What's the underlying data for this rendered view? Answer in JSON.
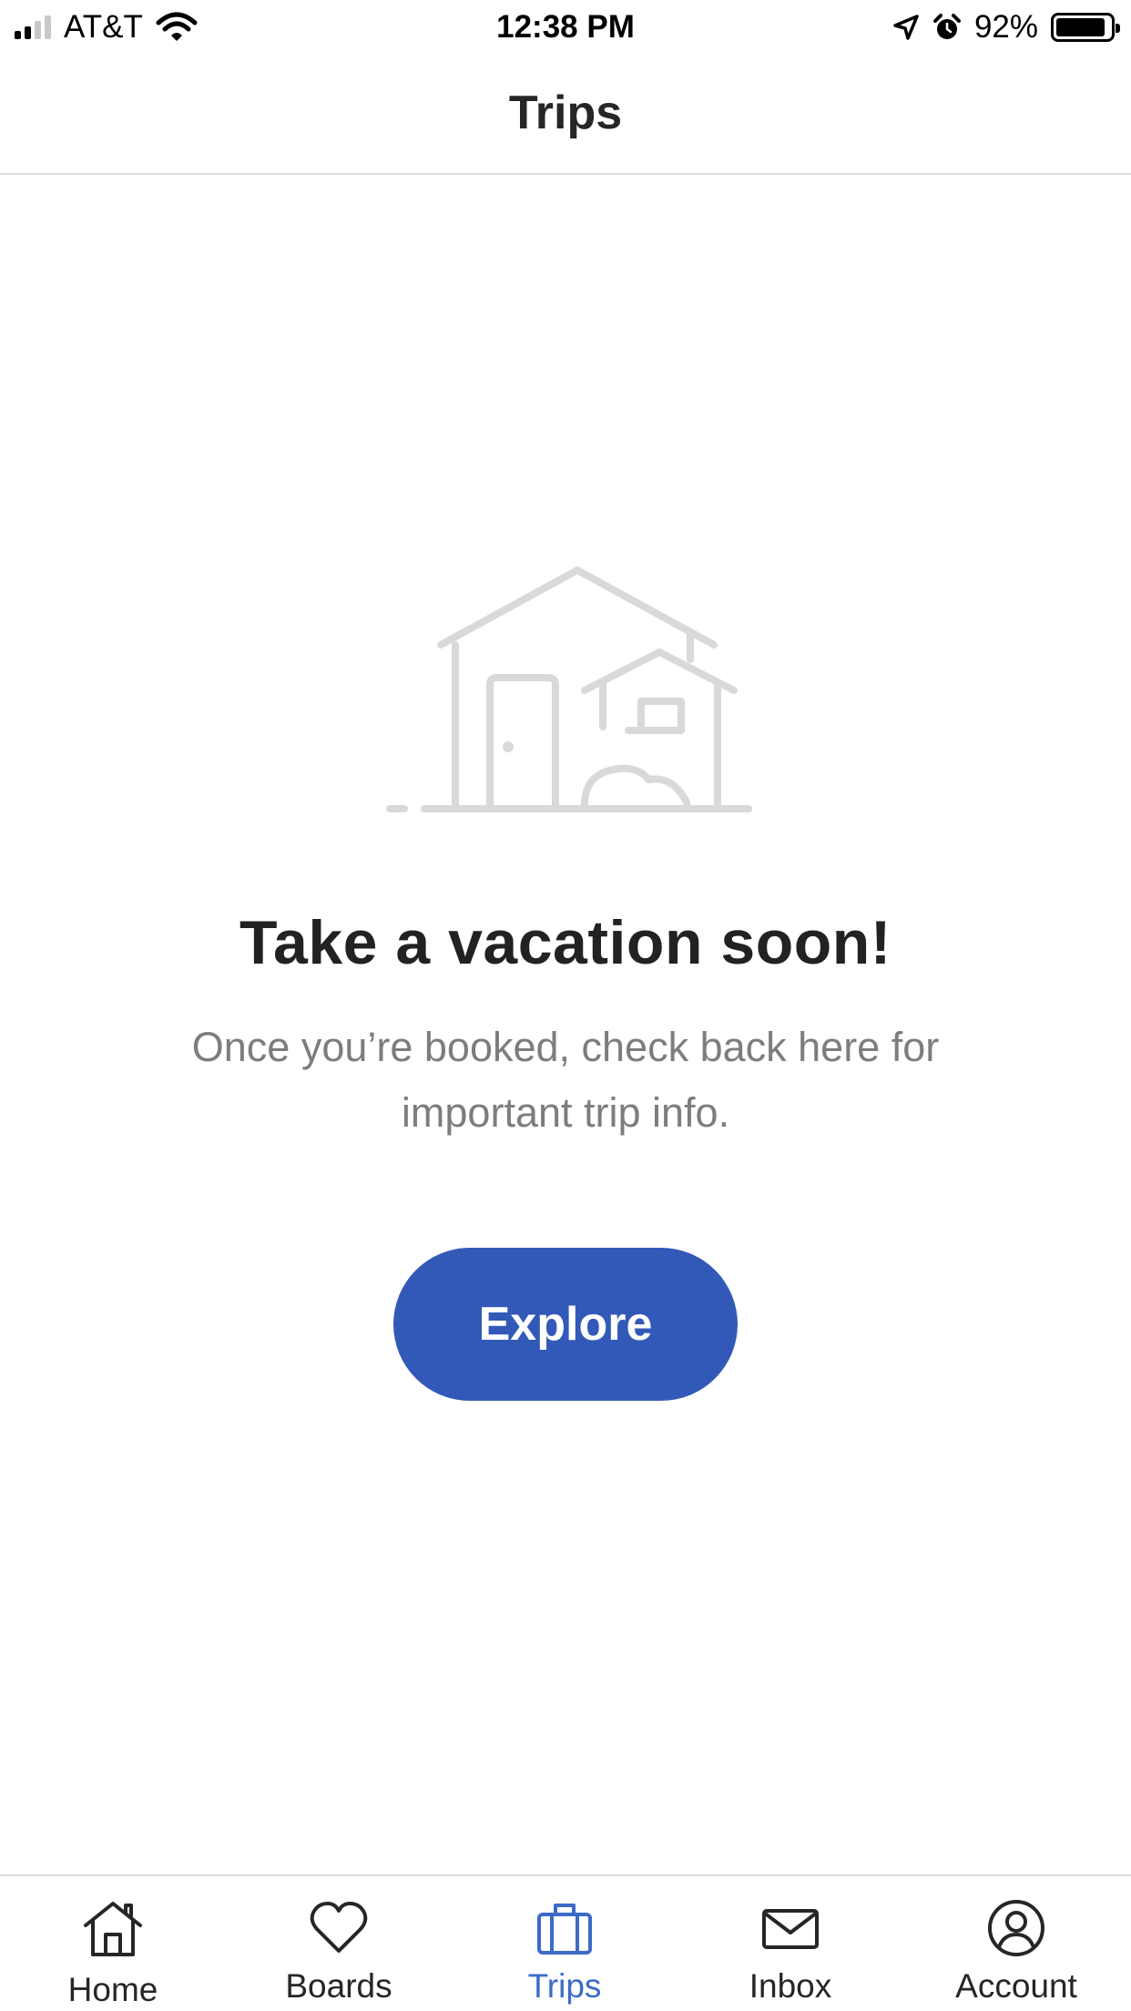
{
  "status_bar": {
    "carrier": "AT&T",
    "time": "12:38 PM",
    "battery_percent_text": "92%",
    "battery_level": 0.92,
    "signal_bars_filled": 2,
    "signal_bars_total": 4,
    "icons": [
      "signal-icon",
      "wifi-icon",
      "location-arrow-icon",
      "alarm-icon",
      "battery-icon"
    ]
  },
  "nav": {
    "title": "Trips"
  },
  "empty_state": {
    "illustration": "house-illustration",
    "headline": "Take a vacation soon!",
    "subtext": "Once you’re booked, check back here for important trip info.",
    "button_label": "Explore"
  },
  "tab_bar": {
    "active_index": 2,
    "tabs": [
      {
        "label": "Home",
        "icon": "home-icon"
      },
      {
        "label": "Boards",
        "icon": "heart-icon"
      },
      {
        "label": "Trips",
        "icon": "suitcase-icon"
      },
      {
        "label": "Inbox",
        "icon": "envelope-icon"
      },
      {
        "label": "Account",
        "icon": "user-icon"
      }
    ]
  },
  "colors": {
    "accent": "#3359b8",
    "active_tab": "#3b6bc6",
    "text_primary": "#222222",
    "text_secondary": "#7d7d7d",
    "illustration": "#d9d9d9",
    "divider": "#dcdcdc"
  }
}
